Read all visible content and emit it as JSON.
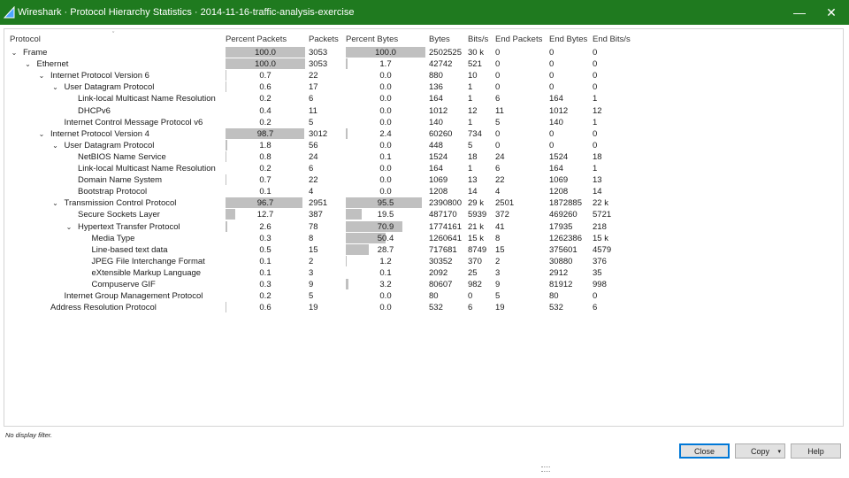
{
  "window": {
    "title": "Wireshark · Protocol Hierarchy Statistics · 2014-11-16-traffic-analysis-exercise",
    "minimize_glyph": "—",
    "close_glyph": "✕"
  },
  "columns": [
    "Protocol",
    "Percent Packets",
    "Packets",
    "Percent Bytes",
    "Bytes",
    "Bits/s",
    "End Packets",
    "End Bytes",
    "End Bits/s"
  ],
  "rows": [
    {
      "level": 0,
      "expanded": true,
      "protocol": "Frame",
      "pct_packets": "100.0",
      "pct_packets_val": 100.0,
      "packets": "3053",
      "pct_bytes": "100.0",
      "pct_bytes_val": 100.0,
      "bytes": "2502525",
      "bits": "30 k",
      "end_packets": "0",
      "end_bytes": "0",
      "end_bits": "0"
    },
    {
      "level": 1,
      "expanded": true,
      "protocol": "Ethernet",
      "pct_packets": "100.0",
      "pct_packets_val": 100.0,
      "packets": "3053",
      "pct_bytes": "1.7",
      "pct_bytes_val": 1.7,
      "bytes": "42742",
      "bits": "521",
      "end_packets": "0",
      "end_bytes": "0",
      "end_bits": "0"
    },
    {
      "level": 2,
      "expanded": true,
      "protocol": "Internet Protocol Version 6",
      "pct_packets": "0.7",
      "pct_packets_val": 0.7,
      "packets": "22",
      "pct_bytes": "0.0",
      "pct_bytes_val": 0.0,
      "bytes": "880",
      "bits": "10",
      "end_packets": "0",
      "end_bytes": "0",
      "end_bits": "0"
    },
    {
      "level": 3,
      "expanded": true,
      "protocol": "User Datagram Protocol",
      "pct_packets": "0.6",
      "pct_packets_val": 0.6,
      "packets": "17",
      "pct_bytes": "0.0",
      "pct_bytes_val": 0.0,
      "bytes": "136",
      "bits": "1",
      "end_packets": "0",
      "end_bytes": "0",
      "end_bits": "0"
    },
    {
      "level": 4,
      "expanded": null,
      "protocol": "Link-local Multicast Name Resolution",
      "pct_packets": "0.2",
      "pct_packets_val": 0.2,
      "packets": "6",
      "pct_bytes": "0.0",
      "pct_bytes_val": 0.0,
      "bytes": "164",
      "bits": "1",
      "end_packets": "6",
      "end_bytes": "164",
      "end_bits": "1"
    },
    {
      "level": 4,
      "expanded": null,
      "protocol": "DHCPv6",
      "pct_packets": "0.4",
      "pct_packets_val": 0.4,
      "packets": "11",
      "pct_bytes": "0.0",
      "pct_bytes_val": 0.0,
      "bytes": "1012",
      "bits": "12",
      "end_packets": "11",
      "end_bytes": "1012",
      "end_bits": "12"
    },
    {
      "level": 3,
      "expanded": null,
      "protocol": "Internet Control Message Protocol v6",
      "pct_packets": "0.2",
      "pct_packets_val": 0.2,
      "packets": "5",
      "pct_bytes": "0.0",
      "pct_bytes_val": 0.0,
      "bytes": "140",
      "bits": "1",
      "end_packets": "5",
      "end_bytes": "140",
      "end_bits": "1"
    },
    {
      "level": 2,
      "expanded": true,
      "protocol": "Internet Protocol Version 4",
      "pct_packets": "98.7",
      "pct_packets_val": 98.7,
      "packets": "3012",
      "pct_bytes": "2.4",
      "pct_bytes_val": 2.4,
      "bytes": "60260",
      "bits": "734",
      "end_packets": "0",
      "end_bytes": "0",
      "end_bits": "0"
    },
    {
      "level": 3,
      "expanded": true,
      "protocol": "User Datagram Protocol",
      "pct_packets": "1.8",
      "pct_packets_val": 1.8,
      "packets": "56",
      "pct_bytes": "0.0",
      "pct_bytes_val": 0.0,
      "bytes": "448",
      "bits": "5",
      "end_packets": "0",
      "end_bytes": "0",
      "end_bits": "0"
    },
    {
      "level": 4,
      "expanded": null,
      "protocol": "NetBIOS Name Service",
      "pct_packets": "0.8",
      "pct_packets_val": 0.8,
      "packets": "24",
      "pct_bytes": "0.1",
      "pct_bytes_val": 0.1,
      "bytes": "1524",
      "bits": "18",
      "end_packets": "24",
      "end_bytes": "1524",
      "end_bits": "18"
    },
    {
      "level": 4,
      "expanded": null,
      "protocol": "Link-local Multicast Name Resolution",
      "pct_packets": "0.2",
      "pct_packets_val": 0.2,
      "packets": "6",
      "pct_bytes": "0.0",
      "pct_bytes_val": 0.0,
      "bytes": "164",
      "bits": "1",
      "end_packets": "6",
      "end_bytes": "164",
      "end_bits": "1"
    },
    {
      "level": 4,
      "expanded": null,
      "protocol": "Domain Name System",
      "pct_packets": "0.7",
      "pct_packets_val": 0.7,
      "packets": "22",
      "pct_bytes": "0.0",
      "pct_bytes_val": 0.0,
      "bytes": "1069",
      "bits": "13",
      "end_packets": "22",
      "end_bytes": "1069",
      "end_bits": "13"
    },
    {
      "level": 4,
      "expanded": null,
      "protocol": "Bootstrap Protocol",
      "pct_packets": "0.1",
      "pct_packets_val": 0.1,
      "packets": "4",
      "pct_bytes": "0.0",
      "pct_bytes_val": 0.0,
      "bytes": "1208",
      "bits": "14",
      "end_packets": "4",
      "end_bytes": "1208",
      "end_bits": "14"
    },
    {
      "level": 3,
      "expanded": true,
      "protocol": "Transmission Control Protocol",
      "pct_packets": "96.7",
      "pct_packets_val": 96.7,
      "packets": "2951",
      "pct_bytes": "95.5",
      "pct_bytes_val": 95.5,
      "bytes": "2390800",
      "bits": "29 k",
      "end_packets": "2501",
      "end_bytes": "1872885",
      "end_bits": "22 k"
    },
    {
      "level": 4,
      "expanded": null,
      "protocol": "Secure Sockets Layer",
      "pct_packets": "12.7",
      "pct_packets_val": 12.7,
      "packets": "387",
      "pct_bytes": "19.5",
      "pct_bytes_val": 19.5,
      "bytes": "487170",
      "bits": "5939",
      "end_packets": "372",
      "end_bytes": "469260",
      "end_bits": "5721"
    },
    {
      "level": 4,
      "expanded": true,
      "protocol": "Hypertext Transfer Protocol",
      "pct_packets": "2.6",
      "pct_packets_val": 2.6,
      "packets": "78",
      "pct_bytes": "70.9",
      "pct_bytes_val": 70.9,
      "bytes": "1774161",
      "bits": "21 k",
      "end_packets": "41",
      "end_bytes": "17935",
      "end_bits": "218"
    },
    {
      "level": 5,
      "expanded": null,
      "protocol": "Media Type",
      "pct_packets": "0.3",
      "pct_packets_val": 0.3,
      "packets": "8",
      "pct_bytes": "50.4",
      "pct_bytes_val": 50.4,
      "bytes": "1260641",
      "bits": "15 k",
      "end_packets": "8",
      "end_bytes": "1262386",
      "end_bits": "15 k"
    },
    {
      "level": 5,
      "expanded": null,
      "protocol": "Line-based text data",
      "pct_packets": "0.5",
      "pct_packets_val": 0.5,
      "packets": "15",
      "pct_bytes": "28.7",
      "pct_bytes_val": 28.7,
      "bytes": "717681",
      "bits": "8749",
      "end_packets": "15",
      "end_bytes": "375601",
      "end_bits": "4579"
    },
    {
      "level": 5,
      "expanded": null,
      "protocol": "JPEG File Interchange Format",
      "pct_packets": "0.1",
      "pct_packets_val": 0.1,
      "packets": "2",
      "pct_bytes": "1.2",
      "pct_bytes_val": 1.2,
      "bytes": "30352",
      "bits": "370",
      "end_packets": "2",
      "end_bytes": "30880",
      "end_bits": "376"
    },
    {
      "level": 5,
      "expanded": null,
      "protocol": "eXtensible Markup Language",
      "pct_packets": "0.1",
      "pct_packets_val": 0.1,
      "packets": "3",
      "pct_bytes": "0.1",
      "pct_bytes_val": 0.1,
      "bytes": "2092",
      "bits": "25",
      "end_packets": "3",
      "end_bytes": "2912",
      "end_bits": "35"
    },
    {
      "level": 5,
      "expanded": null,
      "protocol": "Compuserve GIF",
      "pct_packets": "0.3",
      "pct_packets_val": 0.3,
      "packets": "9",
      "pct_bytes": "3.2",
      "pct_bytes_val": 3.2,
      "bytes": "80607",
      "bits": "982",
      "end_packets": "9",
      "end_bytes": "81912",
      "end_bits": "998"
    },
    {
      "level": 3,
      "expanded": null,
      "protocol": "Internet Group Management Protocol",
      "pct_packets": "0.2",
      "pct_packets_val": 0.2,
      "packets": "5",
      "pct_bytes": "0.0",
      "pct_bytes_val": 0.0,
      "bytes": "80",
      "bits": "0",
      "end_packets": "5",
      "end_bytes": "80",
      "end_bits": "0"
    },
    {
      "level": 2,
      "expanded": null,
      "protocol": "Address Resolution Protocol",
      "pct_packets": "0.6",
      "pct_packets_val": 0.6,
      "packets": "19",
      "pct_bytes": "0.0",
      "pct_bytes_val": 0.0,
      "bytes": "532",
      "bits": "6",
      "end_packets": "19",
      "end_bytes": "532",
      "end_bits": "6"
    }
  ],
  "status": "No display filter.",
  "buttons": {
    "close": "Close",
    "copy": "Copy",
    "help": "Help"
  },
  "colors": {
    "titlebar": "#1f7a1f",
    "percent_bar": "#c0c0c0"
  }
}
